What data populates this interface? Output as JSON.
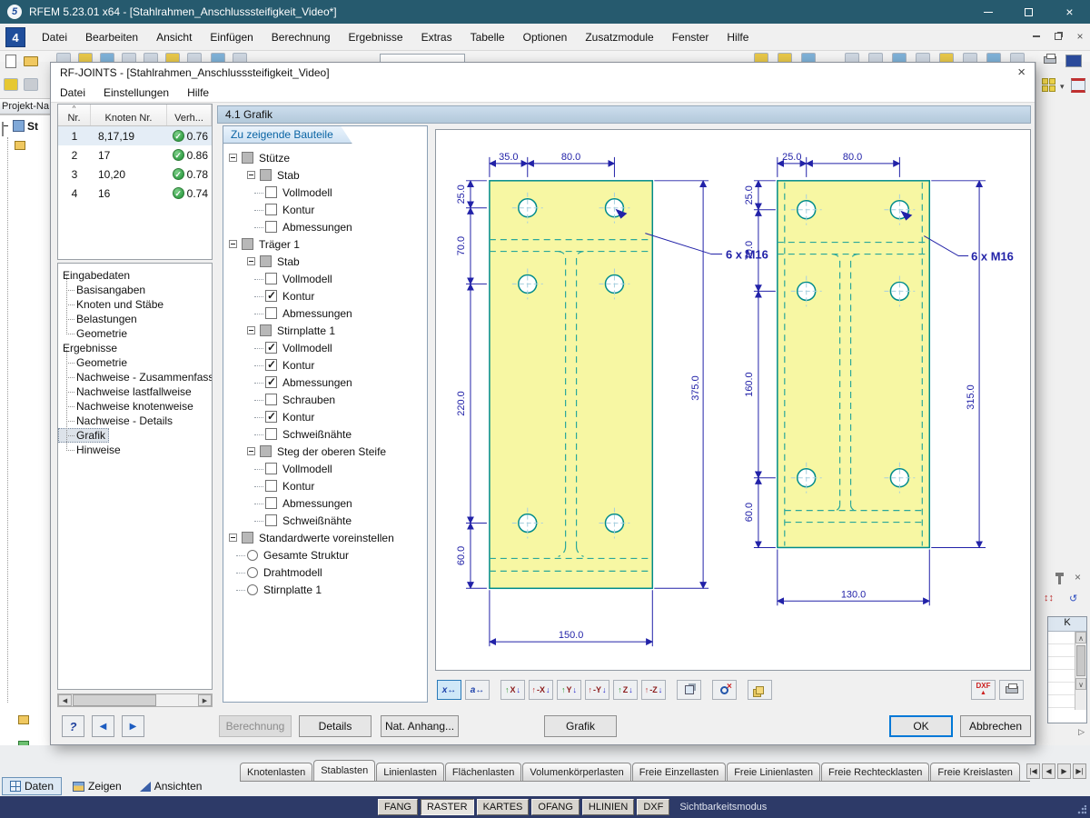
{
  "window": {
    "title": "RFEM 5.23.01 x64 - [Stahlrahmen_Anschlusssteifigkeit_Video*]"
  },
  "main_menu": [
    "Datei",
    "Bearbeiten",
    "Ansicht",
    "Einfügen",
    "Berechnung",
    "Ergebnisse",
    "Extras",
    "Tabelle",
    "Optionen",
    "Zusatzmodule",
    "Fenster",
    "Hilfe"
  ],
  "project_panel": {
    "label": "Projekt-Na",
    "root": "St"
  },
  "dialog": {
    "title": "RF-JOINTS - [Stahlrahmen_Anschlusssteifigkeit_Video]",
    "menu": [
      "Datei",
      "Einstellungen",
      "Hilfe"
    ],
    "section_title": "4.1 Grafik",
    "table": {
      "columns": [
        "Nr.",
        "Knoten Nr.",
        "Verh..."
      ],
      "rows": [
        [
          "1",
          "8,17,19",
          "0.76"
        ],
        [
          "2",
          "17",
          "0.86"
        ],
        [
          "3",
          "10,20",
          "0.78"
        ],
        [
          "4",
          "16",
          "0.74"
        ]
      ],
      "selected_row": 0
    },
    "nav": [
      {
        "label": "Eingabedaten",
        "children": [
          "Basisangaben",
          "Knoten und Stäbe",
          "Belastungen",
          "Geometrie"
        ]
      },
      {
        "label": "Ergebnisse",
        "children": [
          "Geometrie",
          "Nachweise - Zusammenfassung",
          "Nachweise lastfallweise",
          "Nachweise knotenweise",
          "Nachweise - Details",
          "Grafik",
          "Hinweise"
        ]
      }
    ],
    "nav_selected": "Grafik",
    "tree": {
      "title": "Zu zeigende Bauteile",
      "nodes": [
        {
          "level": 0,
          "kind": "parent",
          "state": "mixed",
          "label": "Stütze"
        },
        {
          "level": 1,
          "kind": "parent",
          "state": "mixed",
          "label": "Stab"
        },
        {
          "level": 2,
          "kind": "check",
          "state": "off",
          "label": "Vollmodell"
        },
        {
          "level": 2,
          "kind": "check",
          "state": "off",
          "label": "Kontur"
        },
        {
          "level": 2,
          "kind": "check",
          "state": "off",
          "label": "Abmessungen"
        },
        {
          "level": 0,
          "kind": "parent",
          "state": "mixed",
          "label": "Träger 1"
        },
        {
          "level": 1,
          "kind": "parent",
          "state": "mixed",
          "label": "Stab"
        },
        {
          "level": 2,
          "kind": "check",
          "state": "off",
          "label": "Vollmodell"
        },
        {
          "level": 2,
          "kind": "check",
          "state": "on",
          "label": "Kontur"
        },
        {
          "level": 2,
          "kind": "check",
          "state": "off",
          "label": "Abmessungen"
        },
        {
          "level": 1,
          "kind": "parent",
          "state": "mixed",
          "label": "Stirnplatte 1"
        },
        {
          "level": 2,
          "kind": "check",
          "state": "on",
          "label": "Vollmodell"
        },
        {
          "level": 2,
          "kind": "check",
          "state": "on",
          "label": "Kontur"
        },
        {
          "level": 2,
          "kind": "check",
          "state": "on",
          "label": "Abmessungen"
        },
        {
          "level": 2,
          "kind": "check",
          "state": "off",
          "label": "Schrauben"
        },
        {
          "level": 2,
          "kind": "check",
          "state": "on",
          "label": "Kontur"
        },
        {
          "level": 2,
          "kind": "check",
          "state": "off",
          "label": "Schweißnähte"
        },
        {
          "level": 1,
          "kind": "parent",
          "state": "mixed",
          "label": "Steg der oberen Steife"
        },
        {
          "level": 2,
          "kind": "check",
          "state": "off",
          "label": "Vollmodell"
        },
        {
          "level": 2,
          "kind": "check",
          "state": "off",
          "label": "Kontur"
        },
        {
          "level": 2,
          "kind": "check",
          "state": "off",
          "label": "Abmessungen"
        },
        {
          "level": 2,
          "kind": "check",
          "state": "off",
          "label": "Schweißnähte"
        },
        {
          "level": 0,
          "kind": "parent",
          "state": "mixed",
          "label": "Standardwerte voreinstellen"
        },
        {
          "level": 1,
          "kind": "radio",
          "state": "off",
          "label": "Gesamte Struktur"
        },
        {
          "level": 1,
          "kind": "radio",
          "state": "off",
          "label": "Drahtmodell"
        },
        {
          "level": 1,
          "kind": "radio",
          "state": "off",
          "label": "Stirnplatte 1"
        }
      ]
    },
    "graphic_toolbar": [
      "dim-x",
      "dim-a",
      "view-x",
      "view-minus-x",
      "view-y",
      "view-minus-y",
      "view-z",
      "view-minus-z",
      "view-isometric",
      "zoom-cancel",
      "layers"
    ],
    "graphic_toolbar_labels": {
      "dim-x": "x",
      "dim-a": "a",
      "view-x": "X",
      "view-minus-x": "-X",
      "view-y": "Y",
      "view-minus-y": "-Y",
      "view-z": "Z",
      "view-minus-z": "-Z"
    },
    "dxf_label": "DXF",
    "buttons": {
      "berechnung": "Berechnung",
      "berechnung_disabled": true,
      "details": "Details",
      "nat_anhang": "Nat. Anhang...",
      "grafik": "Grafik",
      "ok": "OK",
      "cancel": "Abbrechen"
    }
  },
  "drawing": {
    "left_plate": {
      "top_dims": [
        "35.0",
        "80.0"
      ],
      "left_dims": [
        "25.0",
        "70.0",
        "220.0",
        "60.0"
      ],
      "height_dim": "375.0",
      "width_dim": "150.0",
      "bolt_label": "6 x M16"
    },
    "right_plate": {
      "top_dims": [
        "25.0",
        "80.0"
      ],
      "left_dims": [
        "25.0",
        "70.0",
        "160.0",
        "60.0"
      ],
      "height_dim": "315.0",
      "width_dim": "130.0",
      "bolt_label": "6 x M16"
    }
  },
  "bottom_tabs": {
    "items": [
      "Knotenlasten",
      "Stablasten",
      "Linienlasten",
      "Flächenlasten",
      "Volumenkörperlasten",
      "Freie Einzellasten",
      "Freie Linienlasten",
      "Freie Rechtecklasten",
      "Freie Kreislasten"
    ],
    "active": "Stablasten"
  },
  "view_tabs": {
    "items": [
      "Daten",
      "Zeigen",
      "Ansichten"
    ],
    "active": "Daten"
  },
  "statusbar": {
    "toggles": [
      "FANG",
      "RASTER",
      "KARTES",
      "OFANG",
      "HLINIEN",
      "DXF"
    ],
    "pressed": "RASTER",
    "mode_label": "Sichtbarkeitsmodus"
  },
  "right_panel": {
    "column": "K"
  },
  "colors": {
    "titlebar": "#265a6e",
    "statusbar": "#2d3a68",
    "accent": "#0078d7",
    "plate_fill": "#f7f7a3",
    "plate_stroke": "#008b8b",
    "contour_dashed": "#2aa79a",
    "dimension": "#2222a8",
    "check_green": "#36a24a"
  }
}
